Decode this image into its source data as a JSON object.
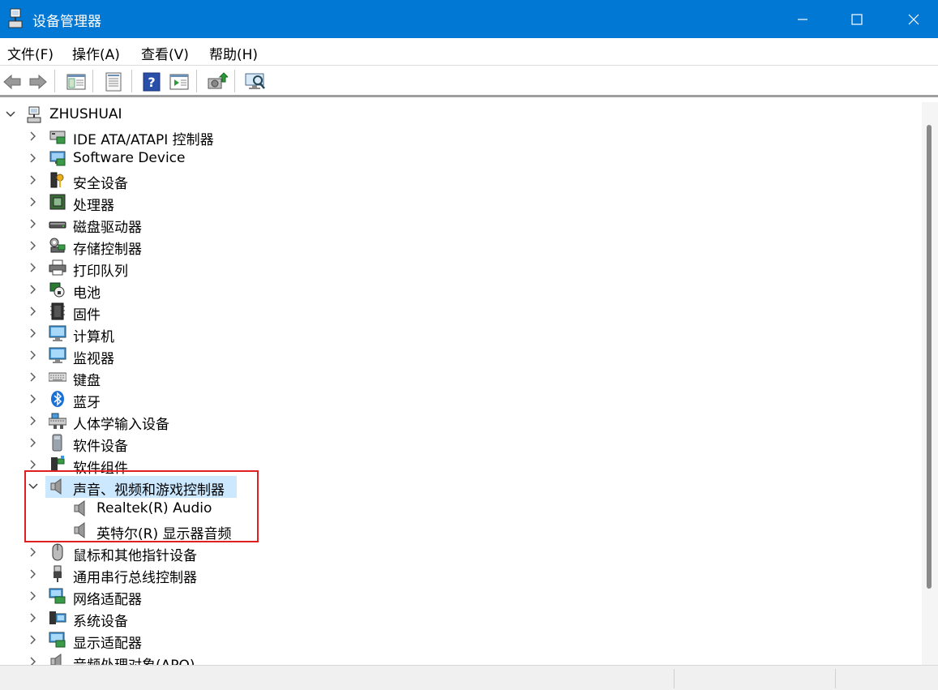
{
  "window": {
    "title": "设备管理器",
    "accent": "#0078d4",
    "buttons": [
      "minimize-icon",
      "maximize-icon",
      "close-icon"
    ]
  },
  "menu": {
    "items": [
      "文件(F)",
      "操作(A)",
      "查看(V)",
      "帮助(H)"
    ]
  },
  "toolbar": {
    "icons": [
      "back-arrow-icon",
      "forward-arrow-icon",
      "show-hide-console-tree-icon",
      "properties-icon",
      "help-icon",
      "run-action-icon",
      "update-driver-icon",
      "scan-hardware-icon"
    ]
  },
  "tree": {
    "root": "ZHUSHUAI",
    "categories": [
      {
        "label": "IDE ATA/ATAPI 控制器",
        "icon": "ide-controller-icon",
        "expanded": false
      },
      {
        "label": "Software Device",
        "icon": "software-device-icon",
        "expanded": false
      },
      {
        "label": "安全设备",
        "icon": "security-device-icon",
        "expanded": false
      },
      {
        "label": "处理器",
        "icon": "processor-icon",
        "expanded": false
      },
      {
        "label": "磁盘驱动器",
        "icon": "disk-drive-icon",
        "expanded": false
      },
      {
        "label": "存储控制器",
        "icon": "storage-controller-icon",
        "expanded": false
      },
      {
        "label": "打印队列",
        "icon": "printer-icon",
        "expanded": false
      },
      {
        "label": "电池",
        "icon": "battery-icon",
        "expanded": false
      },
      {
        "label": "固件",
        "icon": "firmware-icon",
        "expanded": false
      },
      {
        "label": "计算机",
        "icon": "computer-icon",
        "expanded": false
      },
      {
        "label": "监视器",
        "icon": "monitor-icon",
        "expanded": false
      },
      {
        "label": "键盘",
        "icon": "keyboard-icon",
        "expanded": false
      },
      {
        "label": "蓝牙",
        "icon": "bluetooth-icon",
        "expanded": false
      },
      {
        "label": "人体学输入设备",
        "icon": "hid-icon",
        "expanded": false
      },
      {
        "label": "软件设备",
        "icon": "software-device-icon",
        "expanded": false
      },
      {
        "label": "软件组件",
        "icon": "software-component-icon",
        "expanded": false
      },
      {
        "label": "声音、视频和游戏控制器",
        "icon": "speaker-icon",
        "expanded": true,
        "selected": true,
        "children": [
          {
            "label": "Realtek(R) Audio",
            "icon": "speaker-icon"
          },
          {
            "label": "英特尔(R) 显示器音频",
            "icon": "speaker-icon"
          }
        ]
      },
      {
        "label": "鼠标和其他指针设备",
        "icon": "mouse-icon",
        "expanded": false
      },
      {
        "label": "通用串行总线控制器",
        "icon": "usb-icon",
        "expanded": false
      },
      {
        "label": "网络适配器",
        "icon": "network-adapter-icon",
        "expanded": false
      },
      {
        "label": "系统设备",
        "icon": "system-device-icon",
        "expanded": false
      },
      {
        "label": "显示适配器",
        "icon": "display-adapter-icon",
        "expanded": false
      },
      {
        "label": "音频处理对象(APO)",
        "icon": "audio-processing-icon",
        "expanded": false
      }
    ]
  }
}
